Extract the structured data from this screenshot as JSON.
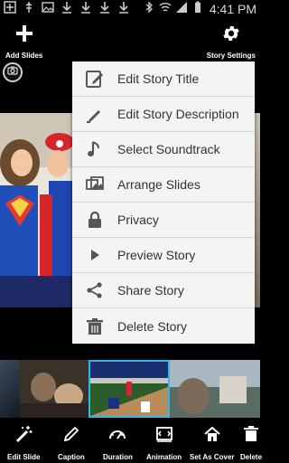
{
  "status_bar": {
    "time": "4:41 PM",
    "icons": [
      "add-icon",
      "usb-icon",
      "image-icon",
      "download-icon",
      "download-icon",
      "download-icon",
      "download-icon",
      "bluetooth-icon",
      "wifi-icon",
      "signal-icon",
      "battery-icon"
    ]
  },
  "top_bar": {
    "add_slides_label": "Add Slides",
    "story_settings_label": "Story Settings"
  },
  "menu": {
    "items": [
      {
        "label": "Edit Story Title",
        "icon": "edit-icon"
      },
      {
        "label": "Edit Story Description",
        "icon": "pencil-icon"
      },
      {
        "label": "Select Soundtrack",
        "icon": "music-note-icon"
      },
      {
        "label": "Arrange Slides",
        "icon": "arrange-icon"
      },
      {
        "label": "Privacy",
        "icon": "lock-icon"
      },
      {
        "label": "Preview Story",
        "icon": "play-icon"
      },
      {
        "label": "Share Story",
        "icon": "share-icon"
      },
      {
        "label": "Delete Story",
        "icon": "trash-icon"
      }
    ]
  },
  "bottom_bar": {
    "items": [
      {
        "label": "Edit Slide",
        "icon": "magic-wand-icon"
      },
      {
        "label": "Caption",
        "icon": "pencil-icon"
      },
      {
        "label": "Duration",
        "icon": "gauge-icon"
      },
      {
        "label": "Animation",
        "icon": "animation-icon"
      },
      {
        "label": "Set As Cover",
        "icon": "home-icon"
      },
      {
        "label": "Delete",
        "icon": "trash-icon"
      }
    ]
  },
  "colors": {
    "accent": "#33b5e5",
    "menu_bg": "#f4f4f4",
    "menu_text": "#333333"
  }
}
